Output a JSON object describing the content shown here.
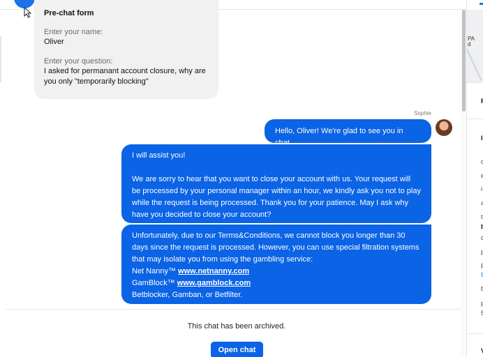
{
  "prechat": {
    "title": "Pre-chat form",
    "name_label": "Enter your name:",
    "name_value": "Oliver",
    "question_label": "Enter your question:",
    "question_line1": "I asked for permanant account closure, why are",
    "question_line2": "you only \"temporarily blocking\""
  },
  "messages": {
    "sender": "Sophie",
    "greeting": "Hello, Oliver! We're glad to see you in chat.",
    "m2_p1": "I will assist you!",
    "m2_p2_l1": "We are sorry to hear that you want to close your account with us. Your request will",
    "m2_p2_l2": "be processed by your personal manager within an hour, we kindly ask you not to play",
    "m2_p2_l3": "while the request is being processed. Thank you for your patience. May I ask why",
    "m2_p2_l4": "have you decided to close your account?",
    "m3_l1": "Unfortunately, due to our Terms&Conditions, we cannot block you longer than 30",
    "m3_l2": "days since the request is processed. However, you can use special filtration systems",
    "m3_l3": "that may isolate you from using the gambling service:",
    "netnanny_prefix": "Net Nanny™ ",
    "netnanny_link": "www.netnanny.com",
    "gamblock_prefix": "GamBlock™ ",
    "gamblock_link": "www.gamblock.com",
    "m3_l6": "Betblocker, Gamban, or Betfilter."
  },
  "footer": {
    "archived_text": "This chat has been archived.",
    "open_chat_label": "Open chat"
  },
  "right_panel": {
    "map_text": "PA\nd",
    "chars": [
      "F",
      "I",
      "c",
      "e",
      "i",
      "a",
      "t",
      "b",
      "c",
      "p",
      "p",
      "8",
      "b",
      "p",
      "5",
      "V"
    ]
  },
  "colors": {
    "bubble_blue": "#0b63e5",
    "prechat_bg": "#f1f1f1"
  },
  "icons": {
    "cursor": "mouse-pointer-icon",
    "user_avatar": "user-avatar-photo"
  }
}
